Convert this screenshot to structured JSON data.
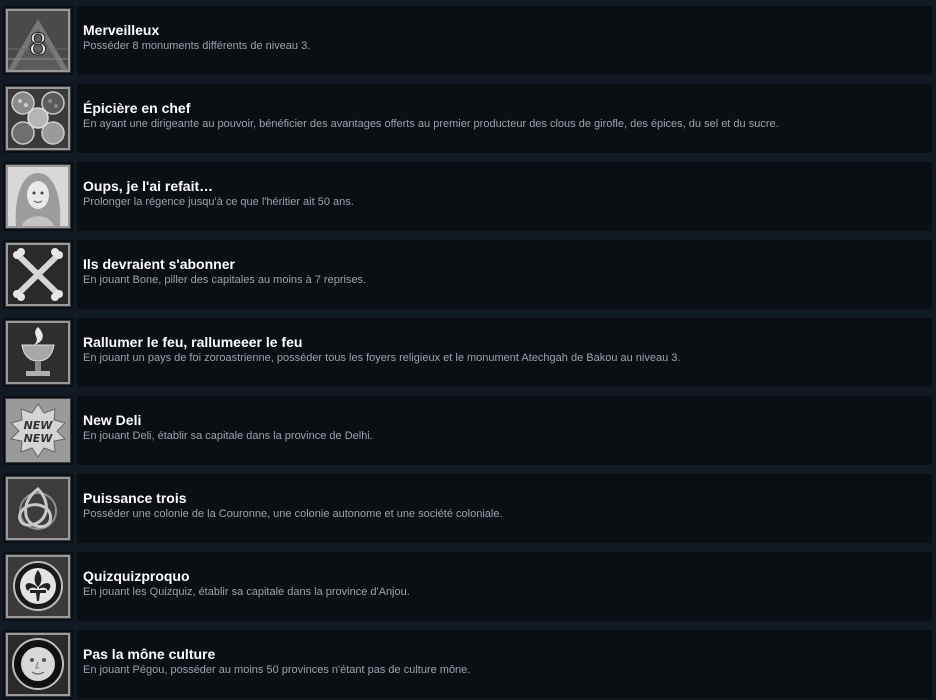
{
  "achievements": [
    {
      "title": "Merveilleux",
      "description": "Posséder 8 monuments différents de niveau 3.",
      "icon": "number-eight-pyramid-icon"
    },
    {
      "title": "Épicière en chef",
      "description": "En ayant une dirigeante au pouvoir, bénéficier des avantages offerts au premier producteur des clous de girofle, des épices, du sel et du sucre.",
      "icon": "spice-bowls-icon"
    },
    {
      "title": "Oups, je l'ai refait…",
      "description": "Prolonger la régence jusqu'à ce que l'héritier ait 50 ans.",
      "icon": "woman-portrait-icon"
    },
    {
      "title": "Ils devraient s'abonner",
      "description": "En jouant Bone, piller des capitales au moins à 7 reprises.",
      "icon": "crossed-bones-icon"
    },
    {
      "title": "Rallumer le feu, rallumeeer le feu",
      "description": "En jouant un pays de foi zoroastrienne, posséder tous les foyers religieux et le monument Atechgah de Bakou au niveau 3.",
      "icon": "fire-chalice-icon"
    },
    {
      "title": "New Deli",
      "description": "En jouant Deli, établir sa capitale dans la province de Delhi.",
      "icon": "new-new-badge-icon"
    },
    {
      "title": "Puissance trois",
      "description": "Posséder une colonie de la Couronne, une colonie autonome et une société coloniale.",
      "icon": "triquetra-knot-icon"
    },
    {
      "title": "Quizquizproquo",
      "description": "En jouant les Quizquiz, établir sa capitale dans la province d'Anjou.",
      "icon": "fleur-de-lis-icon"
    },
    {
      "title": "Pas la mône culture",
      "description": "En jouant Pégou, posséder au moins 50 provinces n'étant pas de culture mône.",
      "icon": "moon-face-icon"
    }
  ]
}
